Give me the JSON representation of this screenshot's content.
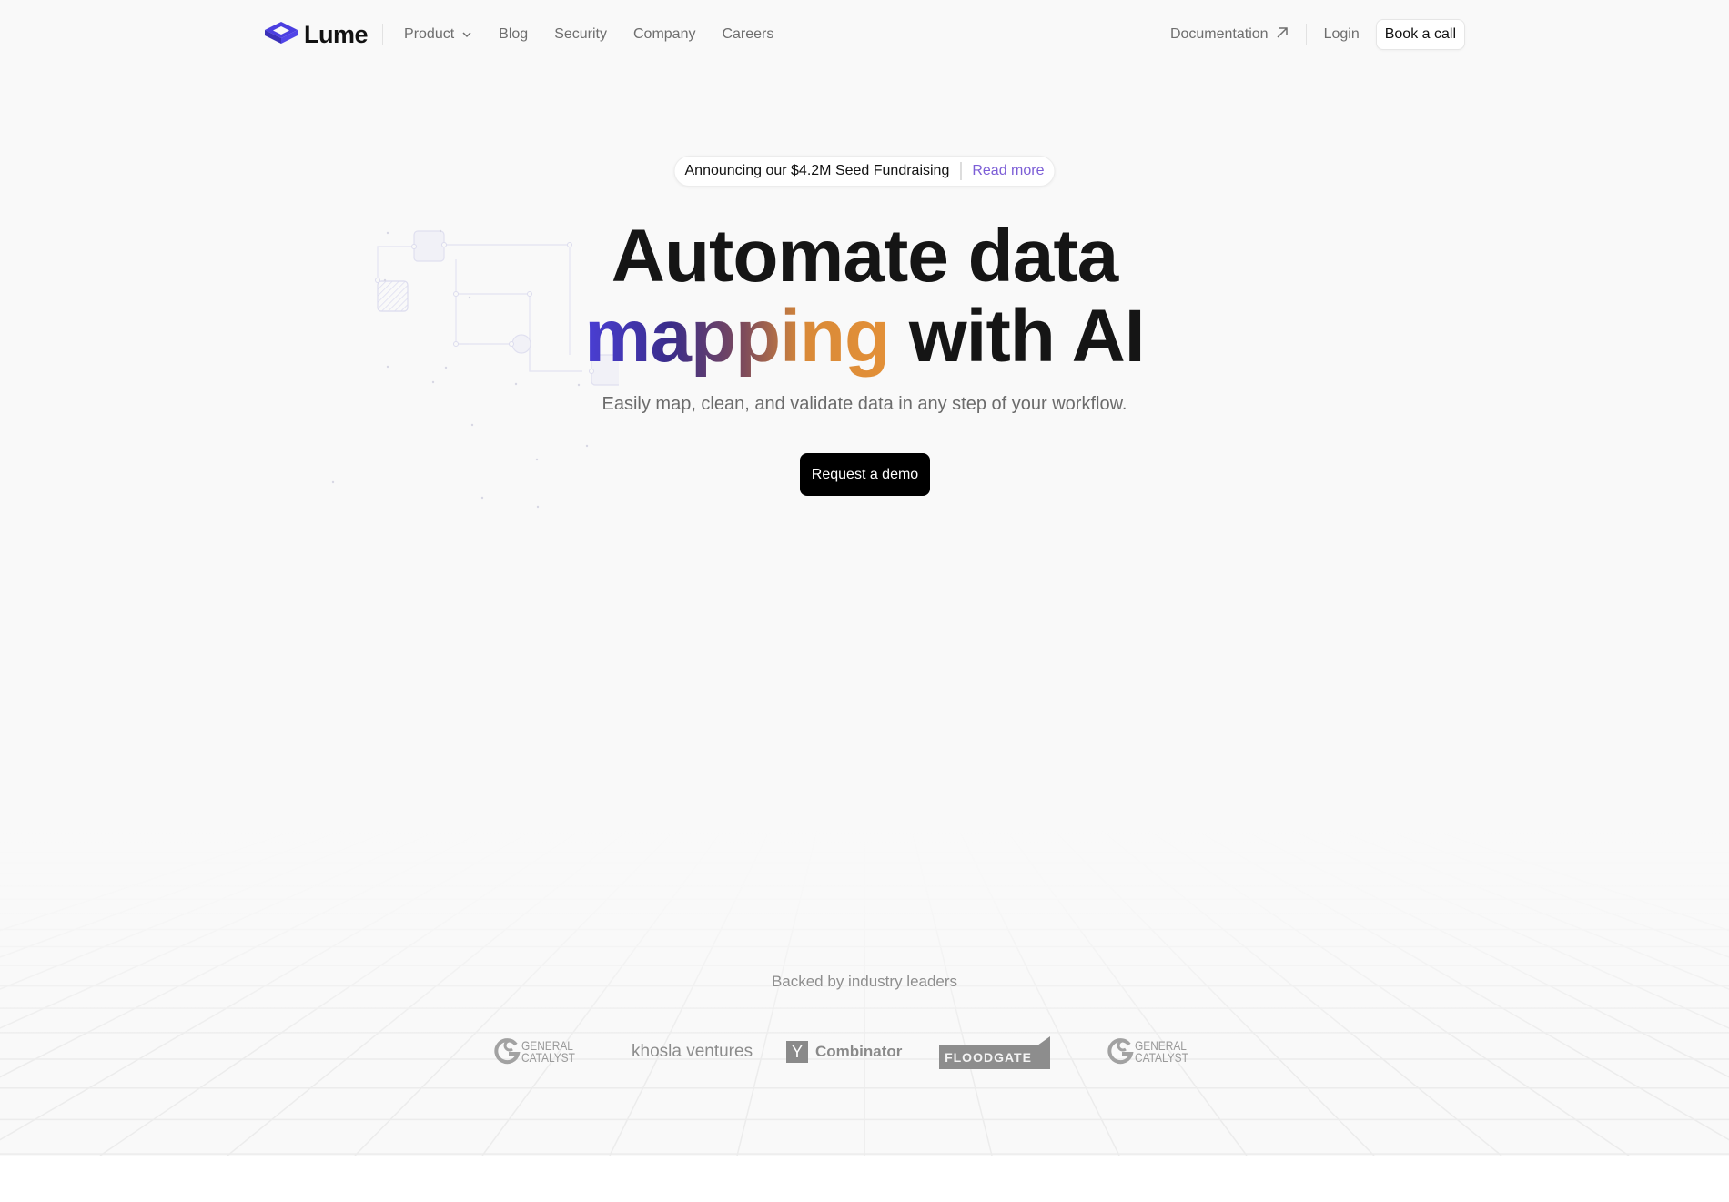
{
  "nav": {
    "brand": "Lume",
    "brand_color": "#4b3fe0",
    "links": [
      {
        "label": "Product",
        "has_dropdown": true
      },
      {
        "label": "Blog"
      },
      {
        "label": "Security"
      },
      {
        "label": "Company"
      },
      {
        "label": "Careers"
      }
    ],
    "documentation_label": "Documentation",
    "login_label": "Login",
    "book_call_label": "Book a call"
  },
  "announcement": {
    "text": "Announcing our $4.2M Seed Fundraising",
    "link_label": "Read more",
    "link_color": "#7c5ed6"
  },
  "hero": {
    "headline_line1": "Automate data",
    "headline_gradient_word": "mapping",
    "headline_line2_rest": "with AI",
    "subheadline": "Easily map, clean, and validate data in any step of your workflow.",
    "cta_label": "Request a demo"
  },
  "backers": {
    "title": "Backed by industry leaders",
    "logos": [
      {
        "name": "General Catalyst",
        "line1": "GENERAL",
        "line2": "CATALYST"
      },
      {
        "name": "khosla ventures"
      },
      {
        "name": "Y Combinator",
        "mark": "Y",
        "text": "Combinator"
      },
      {
        "name": "FLOODGATE"
      },
      {
        "name": "General Catalyst",
        "line1": "GENERAL",
        "line2": "CATALYST"
      }
    ]
  }
}
